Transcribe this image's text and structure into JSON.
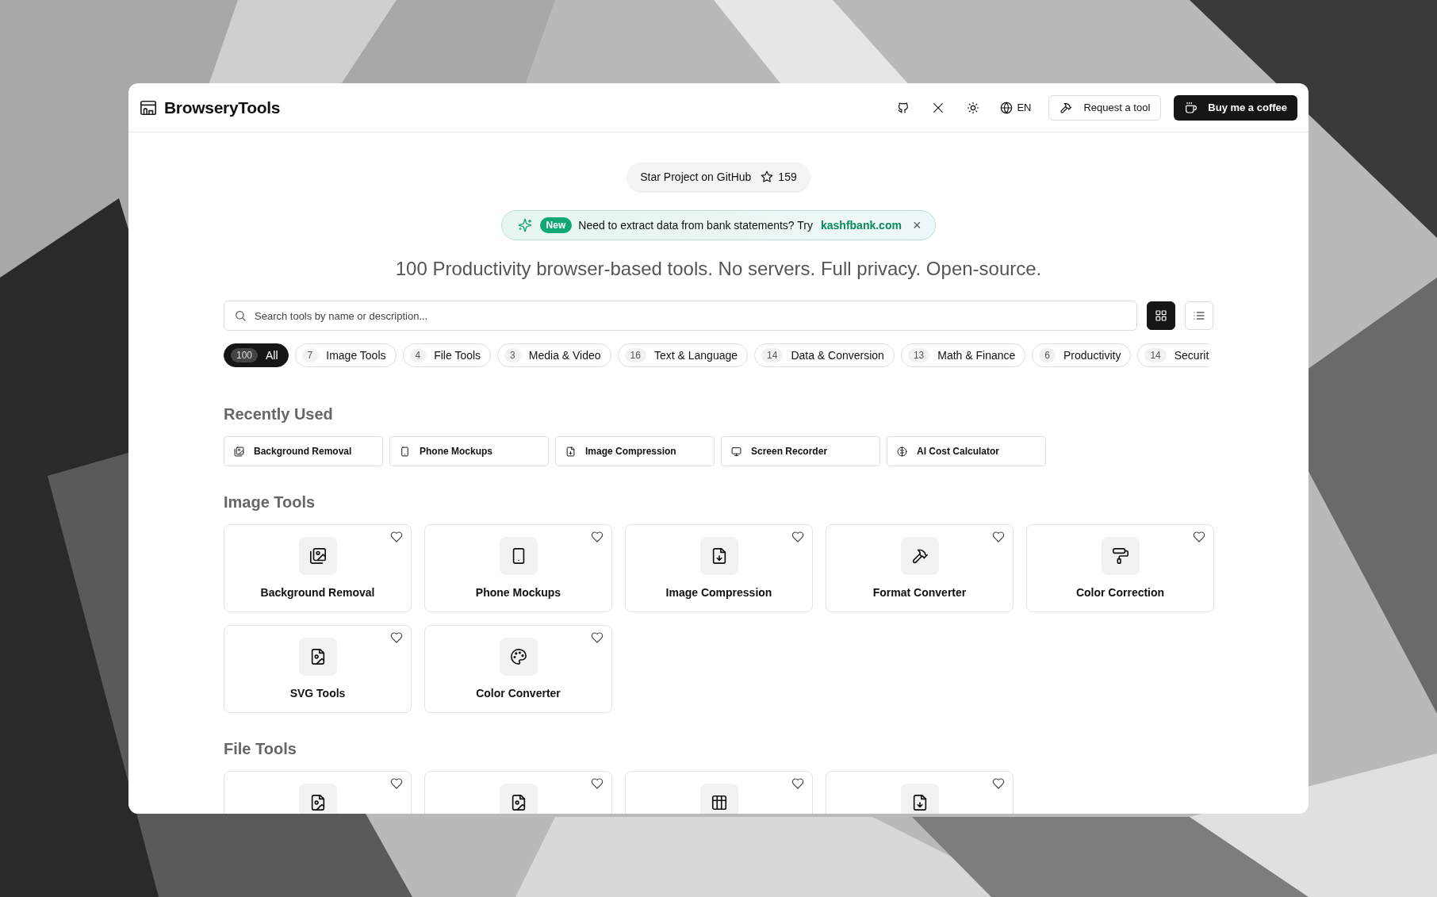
{
  "header": {
    "logo": "BrowseryTools",
    "language": "EN",
    "request_button": "Request a tool",
    "coffee_button": "Buy me a coffee"
  },
  "star_pill": {
    "label": "Star Project on GitHub",
    "count": "159"
  },
  "banner": {
    "badge": "New",
    "text": "Need to extract data from bank statements? Try",
    "link": "kashfbank.com",
    "close": "×"
  },
  "tagline": "100 Productivity browser-based tools. No servers. Full privacy. Open-source.",
  "search": {
    "placeholder": "Search tools by name or description..."
  },
  "view_toggle": [
    {
      "selected": true
    },
    {
      "selected": false
    }
  ],
  "categories": [
    {
      "count": "100",
      "label": "All",
      "selected": true
    },
    {
      "count": "7",
      "label": "Image Tools",
      "selected": false
    },
    {
      "count": "4",
      "label": "File Tools",
      "selected": false
    },
    {
      "count": "3",
      "label": "Media & Video",
      "selected": false
    },
    {
      "count": "16",
      "label": "Text & Language",
      "selected": false
    },
    {
      "count": "14",
      "label": "Data & Conversion",
      "selected": false
    },
    {
      "count": "13",
      "label": "Math & Finance",
      "selected": false
    },
    {
      "count": "6",
      "label": "Productivity",
      "selected": false
    },
    {
      "count": "14",
      "label": "Securit",
      "selected": false
    }
  ],
  "recently_used": {
    "title": "Recently Used",
    "items": [
      "Background Removal",
      "Phone Mockups",
      "Image Compression",
      "Screen Recorder",
      "AI Cost Calculator"
    ]
  },
  "sections": [
    {
      "title": "Image Tools",
      "tools": [
        {
          "name": "Background Removal",
          "favorite": false
        },
        {
          "name": "Phone Mockups",
          "favorite": false
        },
        {
          "name": "Image Compression",
          "favorite": false
        },
        {
          "name": "Format Converter",
          "favorite": false
        },
        {
          "name": "Color Correction",
          "favorite": false
        },
        {
          "name": "SVG Tools",
          "favorite": false
        },
        {
          "name": "Color Converter",
          "favorite": false
        }
      ]
    },
    {
      "title": "File Tools",
      "tools": [
        {
          "favorite": false
        },
        {
          "favorite": false
        },
        {
          "favorite": false
        },
        {
          "favorite": false
        }
      ]
    }
  ]
}
